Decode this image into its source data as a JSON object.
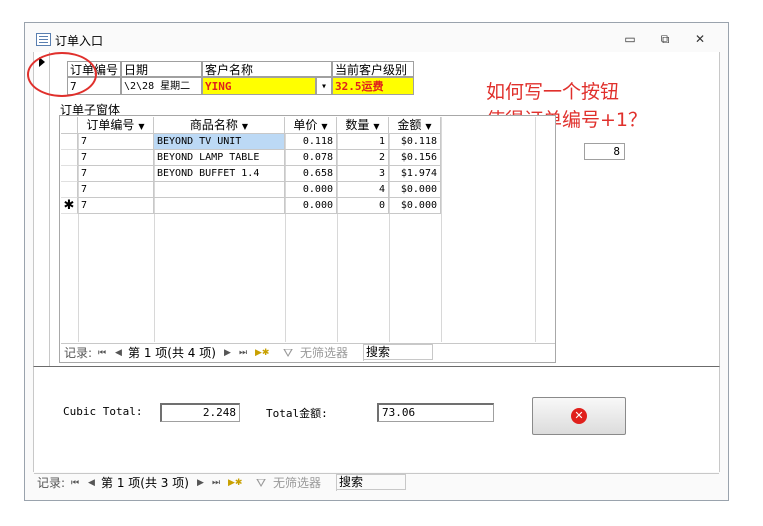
{
  "window": {
    "title": "订单入口",
    "min_label": "▭",
    "restore_label": "⧉",
    "close_label": "✕"
  },
  "header": {
    "cols": [
      "订单编号",
      "日期",
      "客户名称",
      "当前客户级别"
    ],
    "values": {
      "order_no": "7",
      "date": "\\2\\28 星期二",
      "customer": "YING",
      "level": "32.5运费"
    },
    "dropdown_arrow": "▾"
  },
  "annotation": {
    "line1": "如何写一个按钮",
    "line2": "使得订单编号+1？"
  },
  "subform": {
    "label": "订单子窗体",
    "columns": [
      "订单编号",
      "商品名称",
      "单价",
      "数量",
      "金额"
    ],
    "rows": [
      {
        "sel": "",
        "order": "7",
        "product": "BEYOND TV UNIT",
        "price": "0.118",
        "qty": "1",
        "amount": "$0.118"
      },
      {
        "sel": "",
        "order": "7",
        "product": "BEYOND LAMP TABLE",
        "price": "0.078",
        "qty": "2",
        "amount": "$0.156"
      },
      {
        "sel": "",
        "order": "7",
        "product": "BEYOND BUFFET 1.4",
        "price": "0.658",
        "qty": "3",
        "amount": "$1.974"
      },
      {
        "sel": "",
        "order": "7",
        "product": "",
        "price": "0.000",
        "qty": "4",
        "amount": "$0.000"
      },
      {
        "sel": "✱",
        "order": "7",
        "product": "",
        "price": "0.000",
        "qty": "0",
        "amount": "$0.000"
      }
    ],
    "nav": {
      "label": "记录:",
      "first": "⏮",
      "prev": "◀",
      "position": "第 1 项(共 4 项)",
      "next": "▶",
      "last": "⏭",
      "new": "▶✱",
      "filter": "无筛选器",
      "search": "搜索"
    }
  },
  "side_value": "8",
  "footer": {
    "cubic_label": "Cubic Total:",
    "cubic_value": "2.248",
    "total_label": "Total金额:",
    "total_value": "73.06"
  },
  "bottomnav": {
    "label": "记录:",
    "first": "⏮",
    "prev": "◀",
    "position": "第 1 项(共 3 项)",
    "next": "▶",
    "last": "⏭",
    "new": "▶✱",
    "filter": "无筛选器",
    "search": "搜索"
  },
  "colors": {
    "highlight": "#ffff00",
    "annotation_red": "#e0302c",
    "selected_row": "#bcd9f5"
  }
}
